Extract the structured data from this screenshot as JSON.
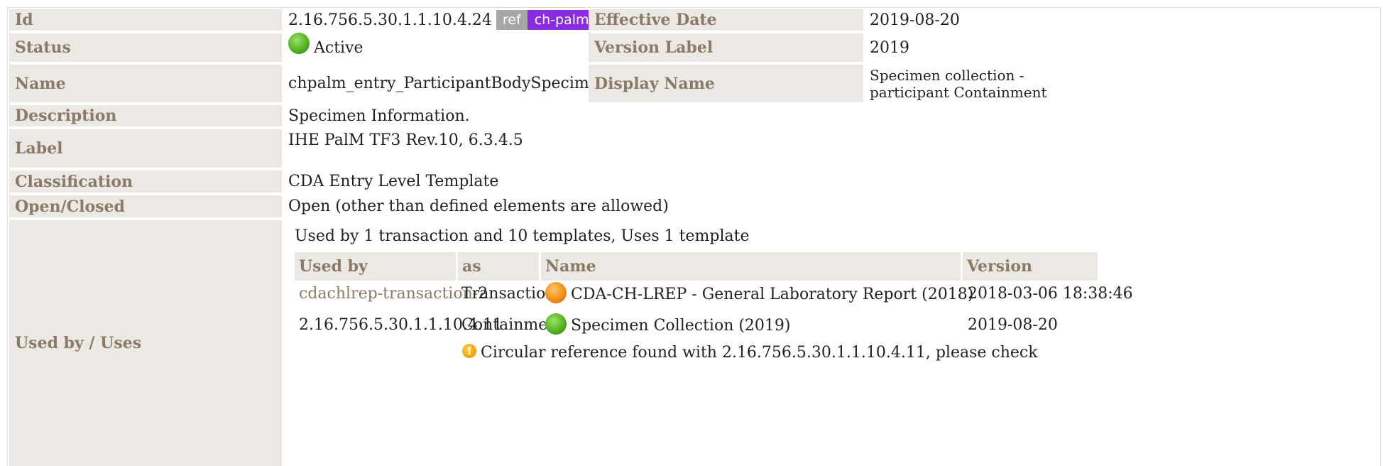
{
  "rows": {
    "id": {
      "label": "Id",
      "value": "2.16.756.5.30.1.1.10.4.24",
      "ref_badge": "ref",
      "prefix_badge": "ch-palm-"
    },
    "effective_date": {
      "label": "Effective Date",
      "value": "2019-08-20"
    },
    "status": {
      "label": "Status",
      "value": "Active"
    },
    "version_label": {
      "label": "Version Label",
      "value": "2019"
    },
    "name": {
      "label": "Name",
      "value": "chpalm_entry_ParticipantBodySpecimenCollection"
    },
    "display_name": {
      "label": "Display Name",
      "value": "Specimen collection - participant Containment"
    },
    "description": {
      "label": "Description",
      "value": "Specimen Information."
    },
    "label": {
      "label": "Label",
      "value": "IHE PalM TF3 Rev.10, 6.3.4.5"
    },
    "classification": {
      "label": "Classification",
      "value": "CDA Entry Level Template"
    },
    "open_closed": {
      "label": "Open/Closed",
      "value": "Open (other than defined elements are allowed)"
    },
    "used_by": {
      "label": "Used by / Uses",
      "summary": "Used by 1 transaction and 10 templates, Uses 1 template"
    }
  },
  "usage_table": {
    "headers": [
      "Used by",
      "as",
      "Name",
      "Version"
    ],
    "rows": [
      {
        "used_by_link": "cdachlrep-transaction-",
        "used_by_suffix": "2",
        "as": "Transaction",
        "status": "orange",
        "name": "CDA-CH-LREP - General Laboratory Report (2018)",
        "version": "2018-03-06 18:38:46"
      },
      {
        "used_by_link": "2.16.756.5.30.1.1.10.4.11",
        "used_by_suffix": "",
        "as": "Containment",
        "status": "green",
        "name": "Specimen Collection (2019)",
        "version": "2019-08-20"
      }
    ],
    "warning": "Circular reference found with 2.16.756.5.30.1.1.10.4.11, please check"
  },
  "colors": {
    "label_bg": "#ece9e4",
    "label_text": "#8a7a66",
    "ref_badge": "#a6a6a6",
    "prefix_badge": "#8a2be2",
    "status_active": "#4caf1c",
    "status_draft": "#f08a10"
  }
}
